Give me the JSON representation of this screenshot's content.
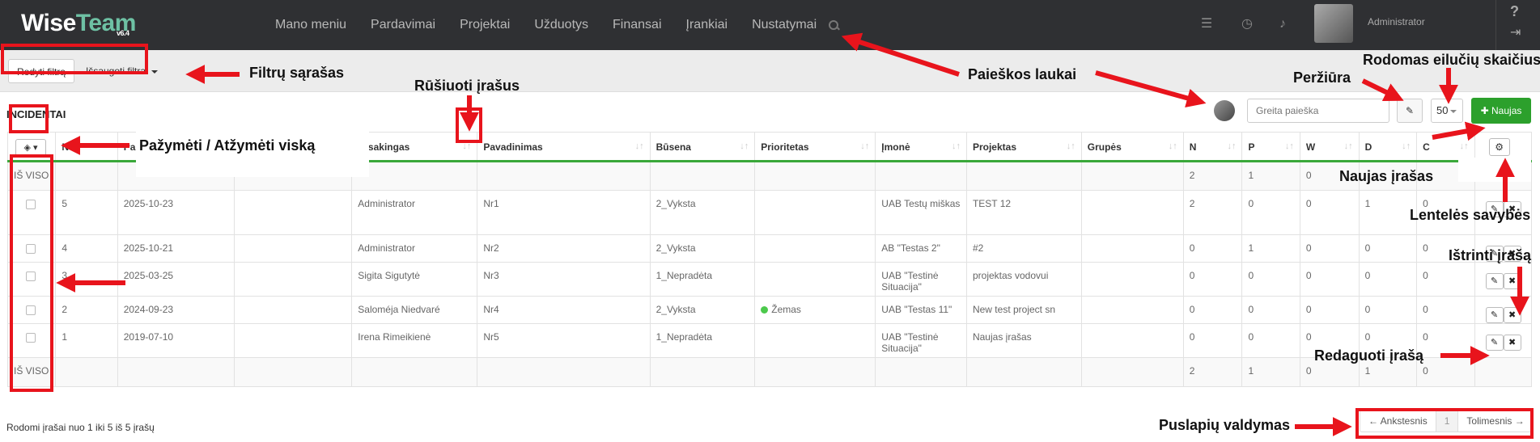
{
  "app": {
    "logo_main": "Wise",
    "logo_accent": "Team",
    "version": "v6.4",
    "user": "Administrator"
  },
  "nav": [
    "Mano meniu",
    "Pardavimai",
    "Projektai",
    "Užduotys",
    "Finansai",
    "Įrankiai",
    "Nustatymai"
  ],
  "topbar_icons": [
    "list-icon",
    "clock-icon",
    "bell-icon",
    "help-icon",
    "logout-icon"
  ],
  "filters": {
    "show_label": "Rodyti filtrą",
    "saved_label": "Išsaugoti filtrai"
  },
  "page": {
    "title": "INCIDENTAI",
    "search_placeholder": "Greita paieška",
    "rows_per_page": "50",
    "new_label": "Naujas"
  },
  "table": {
    "headers": [
      "",
      "N",
      "Pa",
      "",
      "Atsakingas",
      "Pavadinimas",
      "Būsena",
      "Prioritetas",
      "Įmonė",
      "Projektas",
      "Grupės",
      "N",
      "P",
      "W",
      "D",
      "C",
      ""
    ],
    "total_label": "IŠ VISO",
    "totals_top": [
      "2",
      "1",
      "0",
      "",
      ""
    ],
    "totals_bottom": [
      "2",
      "1",
      "0",
      "1",
      "0"
    ],
    "rows": [
      {
        "id": "5",
        "date": "2025-10-23",
        "resp": "Administrator",
        "name": "Nr1",
        "status": "2_Vyksta",
        "priority": "",
        "company": "UAB Testų miškas",
        "project": "TEST 12",
        "n": "2",
        "p": "0",
        "w": "0",
        "d": "1",
        "c": "0"
      },
      {
        "id": "4",
        "date": "2025-10-21",
        "resp": "Administrator",
        "name": "Nr2",
        "status": "2_Vyksta",
        "priority": "",
        "company": "AB \"Testas 2\"",
        "project": "#2",
        "n": "0",
        "p": "1",
        "w": "0",
        "d": "0",
        "c": "0"
      },
      {
        "id": "3",
        "date": "2025-03-25",
        "resp": "Sigita Sigutytė",
        "name": "Nr3",
        "status": "1_Nepradėta",
        "priority": "",
        "company": "UAB \"Testinė Situacija\"",
        "project": "projektas vodovui",
        "n": "0",
        "p": "0",
        "w": "0",
        "d": "0",
        "c": "0"
      },
      {
        "id": "2",
        "date": "2024-09-23",
        "resp": "Saloméja Niedvaré",
        "name": "Nr4",
        "status": "2_Vyksta",
        "priority": "Žemas",
        "company": "UAB \"Testas 11\"",
        "project": "New test project sn",
        "n": "0",
        "p": "0",
        "w": "0",
        "d": "0",
        "c": "0"
      },
      {
        "id": "1",
        "date": "2019-07-10",
        "resp": "Irena Rimeikienė",
        "name": "Nr5",
        "status": "1_Nepradėta",
        "priority": "",
        "company": "UAB \"Testinė Situacija\"",
        "project": "Naujas įrašas",
        "n": "0",
        "p": "0",
        "w": "0",
        "d": "0",
        "c": "0"
      }
    ]
  },
  "footer": {
    "info": "Rodomi įrašai nuo 1 iki 5 iš 5 įrašų",
    "prev": "← Ankstesnis",
    "page": "1",
    "next": "Tolimesnis →"
  },
  "annotations": {
    "filters_list": "Filtrų sąrašas",
    "sort_records": "Rūšiuoti įrašus",
    "search_fields": "Paieškos laukai",
    "preview": "Peržiūra",
    "rows_shown": "Rodomas eilučių skaičius",
    "select_all": "Pažymėti / Atžymėti viską",
    "new_record": "Naujas įrašas",
    "table_props": "Lentelės savybės",
    "delete_record": "Ištrinti įrašą",
    "edit_record": "Redaguoti įrašą",
    "pagination": "Puslapių valdymas"
  },
  "colors": {
    "annotation": "#e8141c",
    "primary": "#2ca02c",
    "topbar": "#2f3033"
  }
}
